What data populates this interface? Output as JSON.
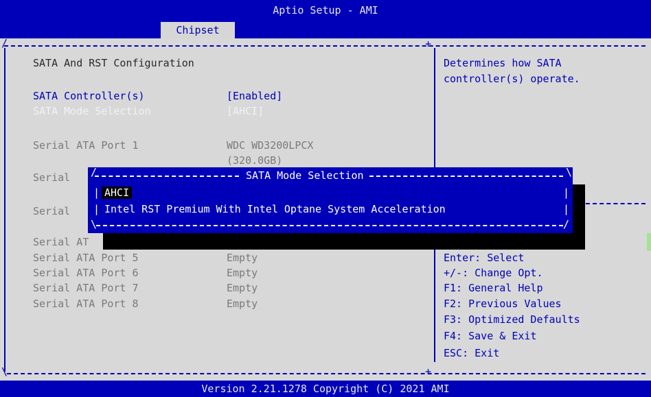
{
  "header": {
    "title": "Aptio Setup - AMI",
    "active_tab": "Chipset"
  },
  "main": {
    "section_title": "SATA And RST Configuration",
    "items": [
      {
        "label": "SATA Controller(s)",
        "value": "[Enabled]"
      },
      {
        "label": "SATA Mode Selection",
        "value": "[AHCI]"
      }
    ],
    "ports": [
      {
        "label": "Serial ATA Port 1",
        "value": "WDC WD3200LPCX",
        "value2": "(320.0GB)"
      },
      {
        "label": "Serial",
        "value": ""
      },
      {
        "label": "Serial",
        "value": ""
      },
      {
        "label": "Serial AT",
        "value": ""
      },
      {
        "label": "Serial ATA Port 5",
        "value": "Empty"
      },
      {
        "label": "Serial ATA Port 6",
        "value": "Empty"
      },
      {
        "label": "Serial ATA Port 7",
        "value": "Empty"
      },
      {
        "label": "Serial ATA Port 8",
        "value": "Empty"
      }
    ]
  },
  "help": {
    "description_line1": "Determines how SATA",
    "description_line2": "controller(s) operate.",
    "keys": [
      "Enter: Select",
      "+/-: Change Opt.",
      "F1: General Help",
      "F2: Previous Values",
      "F3: Optimized Defaults",
      "F4: Save & Exit",
      "ESC: Exit"
    ]
  },
  "popup": {
    "title": "SATA Mode Selection",
    "options": [
      "AHCI",
      "Intel RST Premium With Intel Optane System Acceleration"
    ],
    "selected_index": 0
  },
  "footer": {
    "version": "Version 2.21.1278 Copyright (C) 2021 AMI"
  },
  "colors": {
    "bios_blue": "#0000b8",
    "panel_grey": "#d8d8d8",
    "highlight_white": "#f2f2f2"
  }
}
